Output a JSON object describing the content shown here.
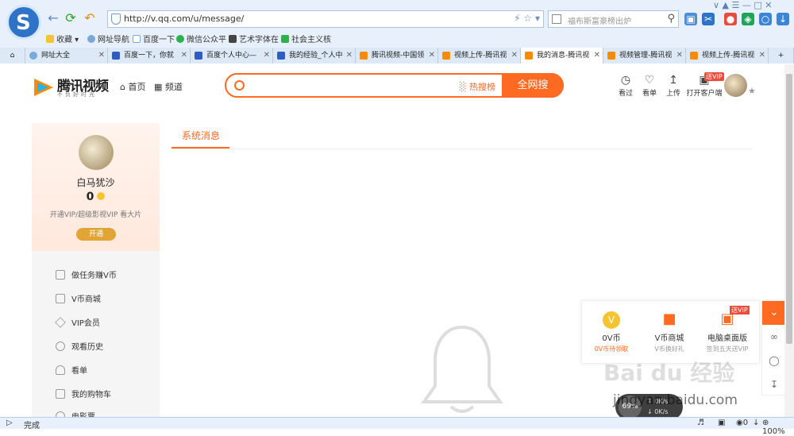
{
  "browser": {
    "url": "http://v.qq.com/u/message/",
    "search_placeholder": "福布斯富豪榜出炉",
    "bookmarks": [
      "收藏",
      "网址导航",
      "百度一下",
      "微信公众平",
      "艺术字体在",
      "社会主义核"
    ],
    "tabs": [
      {
        "label": "网址大全",
        "active": false
      },
      {
        "label": "百度一下，你就",
        "active": false
      },
      {
        "label": "百度个人中心—",
        "active": false
      },
      {
        "label": "我的经验_个人中",
        "active": false
      },
      {
        "label": "腾讯视频-中国领",
        "active": false
      },
      {
        "label": "视频上传-腾讯视",
        "active": false
      },
      {
        "label": "我的消息-腾讯视",
        "active": true
      },
      {
        "label": "视频管理-腾讯视",
        "active": false
      },
      {
        "label": "视频上传-腾讯视",
        "active": false
      }
    ],
    "status": {
      "text": "完成",
      "zoom": "100%",
      "shield_count": "0"
    }
  },
  "site": {
    "logo_text": "腾讯视频",
    "slogan": "不负好时光",
    "nav": [
      "首页",
      "频道"
    ],
    "search": {
      "hot": "热搜榜",
      "button": "全网搜"
    },
    "header_icons": [
      "看过",
      "看单",
      "上传",
      "打开客户端"
    ],
    "vip_badge": "送VIP"
  },
  "profile": {
    "name": "白马犹沙",
    "coins": "0",
    "vip_text": "开通VIP/超级影视VIP 看大片",
    "open_button": "开通"
  },
  "menu": [
    {
      "label": "做任务赚V币",
      "icon": "task-icon"
    },
    {
      "label": "V币商城",
      "icon": "shop-icon"
    },
    {
      "label": "VIP会员",
      "icon": "vip-icon"
    },
    {
      "label": "观看历史",
      "icon": "history-icon"
    },
    {
      "label": "看单",
      "icon": "watchlist-icon"
    },
    {
      "label": "我的购物车",
      "icon": "cart-icon"
    },
    {
      "label": "电影票",
      "icon": "ticket-icon"
    }
  ],
  "main": {
    "tab": "系统消息"
  },
  "float_panel": [
    {
      "title": "0V币",
      "sub": "0V币待领取",
      "icon": "coin-icon"
    },
    {
      "title": "V币商城",
      "sub": "V币换好礼",
      "icon": "bag-icon"
    },
    {
      "title": "电脑桌面版",
      "sub": "签到五天送VIP",
      "icon": "desktop-icon",
      "badge": "送VIP"
    }
  ],
  "speed": {
    "percent": "69%",
    "up": "0K/s",
    "down": "0K/s"
  },
  "watermark": {
    "text": "Bai du 经验",
    "url": "jingyan.baidu.com"
  }
}
